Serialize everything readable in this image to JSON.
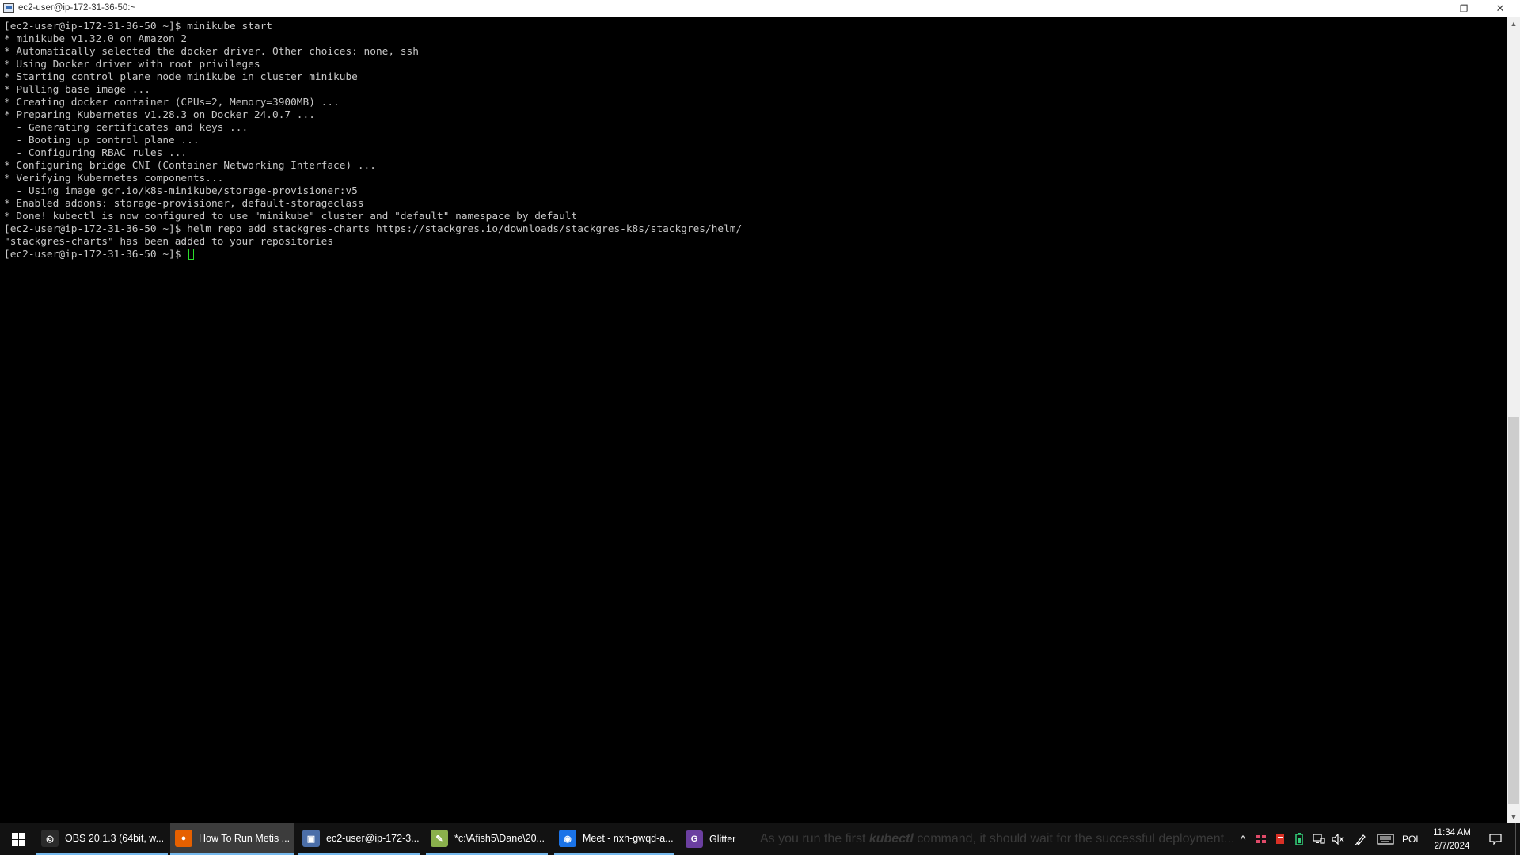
{
  "window": {
    "title": "ec2-user@ip-172-31-36-50:~",
    "icon": "putty-terminal-icon",
    "controls": {
      "minimize": "–",
      "restore": "❐",
      "close": "✕"
    }
  },
  "terminal": {
    "lines": [
      "[ec2-user@ip-172-31-36-50 ~]$ minikube start",
      "* minikube v1.32.0 on Amazon 2",
      "* Automatically selected the docker driver. Other choices: none, ssh",
      "* Using Docker driver with root privileges",
      "* Starting control plane node minikube in cluster minikube",
      "* Pulling base image ...",
      "* Creating docker container (CPUs=2, Memory=3900MB) ...",
      "* Preparing Kubernetes v1.28.3 on Docker 24.0.7 ...",
      "  - Generating certificates and keys ...",
      "  - Booting up control plane ...",
      "  - Configuring RBAC rules ...",
      "* Configuring bridge CNI (Container Networking Interface) ...",
      "* Verifying Kubernetes components...",
      "  - Using image gcr.io/k8s-minikube/storage-provisioner:v5",
      "* Enabled addons: storage-provisioner, default-storageclass",
      "* Done! kubectl is now configured to use \"minikube\" cluster and \"default\" namespace by default",
      "[ec2-user@ip-172-31-36-50 ~]$ helm repo add stackgres-charts https://stackgres.io/downloads/stackgres-k8s/stackgres/helm/",
      "\"stackgres-charts\" has been added to your repositories"
    ],
    "prompt": "[ec2-user@ip-172-31-36-50 ~]$ ",
    "cursor_color": "#2bdc2b"
  },
  "scrollbar": {
    "up": "▲",
    "down": "▼"
  },
  "taskbar": {
    "start_icon": "windows-start-icon",
    "apps": [
      {
        "label": "OBS 20.1.3 (64bit, w...",
        "icon": "obs-icon",
        "glyph": "◎",
        "color": "#2b2b2b",
        "active": false
      },
      {
        "label": "How To Run Metis ...",
        "icon": "firefox-icon",
        "glyph": "●",
        "color": "#e66000",
        "active": true
      },
      {
        "label": "ec2-user@ip-172-3...",
        "icon": "putty-icon",
        "glyph": "▣",
        "color": "#4b6ea8",
        "active": false
      },
      {
        "label": "*c:\\Afish5\\Dane\\20...",
        "icon": "notepad-plus-plus-icon",
        "glyph": "✎",
        "color": "#8ab04c",
        "active": false
      },
      {
        "label": "Meet - nxh-gwqd-a...",
        "icon": "chrome-icon",
        "glyph": "◉",
        "color": "#1a73e8",
        "active": false
      },
      {
        "label": "Glitter",
        "icon": "glitter-icon",
        "glyph": "G",
        "color": "#6b3fa0",
        "active": false
      }
    ],
    "caption_pre": "As you run the first ",
    "caption_bold": "kubectl",
    "caption_post": " command, it should wait for the successful deployment...",
    "tray": {
      "chevron": "^",
      "language": "POL",
      "time": "11:34 AM",
      "date": "2/7/2024"
    }
  }
}
